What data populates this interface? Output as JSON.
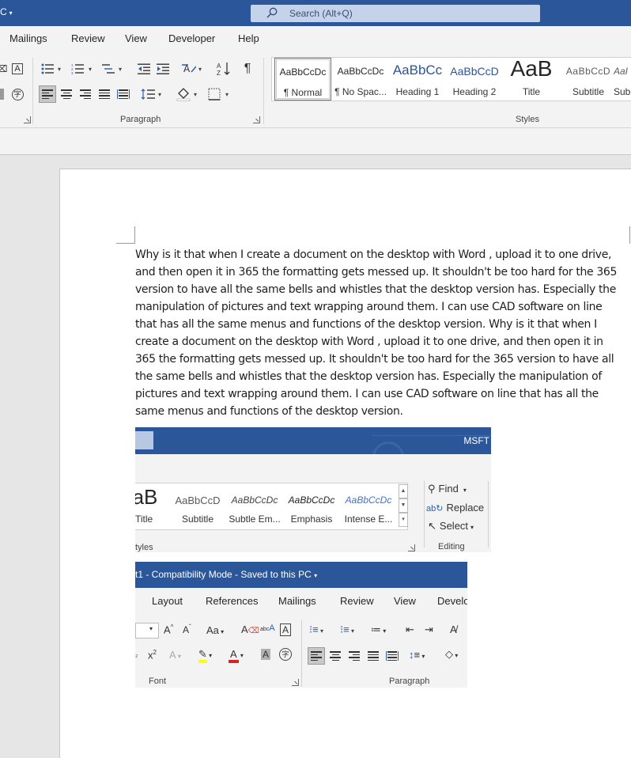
{
  "titlebar": {
    "left_fragment": "C",
    "search_placeholder": "Search (Alt+Q)"
  },
  "tabs": [
    "Mailings",
    "Review",
    "View",
    "Developer",
    "Help"
  ],
  "ribbon": {
    "paragraph_label": "Paragraph",
    "styles_label": "Styles",
    "styles": [
      {
        "preview": "AaBbCcDc",
        "label": "¶ Normal"
      },
      {
        "preview": "AaBbCcDc",
        "label": "¶ No Spac..."
      },
      {
        "preview": "AaBbCc",
        "label": "Heading 1"
      },
      {
        "preview": "AaBbCcD",
        "label": "Heading 2"
      },
      {
        "preview": "AaB",
        "label": "Title"
      },
      {
        "preview": "AaBbCcD",
        "label": "Subtitle"
      },
      {
        "preview": "AaI",
        "label": "Sub"
      }
    ],
    "colors": {
      "title_bar": "#2b579a",
      "accent_blue": "#2e5fa9",
      "highlight_yellow": "#ffff00",
      "font_red": "#e02020"
    }
  },
  "document": {
    "paragraph": "Why is it that when I create a document on the desktop with Word , upload it to one drive, and then open it in 365 the formatting gets messed up. It shouldn't be too hard for the 365 version to have all the same bells and whistles that the desktop version has. Especially the manipulation of pictures and text wrapping around them. I can use CAD software on line that has all the same menus and functions of the desktop version. Why is it that when I create a document on the desktop with Word , upload it to one drive, and then open it in 365 the formatting gets messed up. It shouldn't be too hard for the 365 version to have all the same bells and whistles that the desktop version has. Especially the manipulation of pictures and text wrapping around them. I can use CAD software on line that has all the same menus and functions of the desktop version."
  },
  "image1": {
    "msft": "MSFT",
    "styles": [
      {
        "preview": "aB",
        "label": "Title"
      },
      {
        "preview": "AaBbCcD",
        "label": "Subtitle"
      },
      {
        "preview": "AaBbCcDc",
        "label": "Subtle Em..."
      },
      {
        "preview": "AaBbCcDc",
        "label": "Emphasis"
      },
      {
        "preview": "AaBbCcDc",
        "label": "Intense E..."
      }
    ],
    "find": "Find",
    "replace": "Replace",
    "select": "Select",
    "styles_label": "tyles",
    "editing_label": "Editing"
  },
  "image2": {
    "title": "t1  -  Compatibility Mode  -  Saved to this PC",
    "tabs": [
      "Layout",
      "References",
      "Mailings",
      "Review",
      "View",
      "Develo"
    ],
    "font_label": "Font",
    "paragraph_label": "Paragraph"
  }
}
